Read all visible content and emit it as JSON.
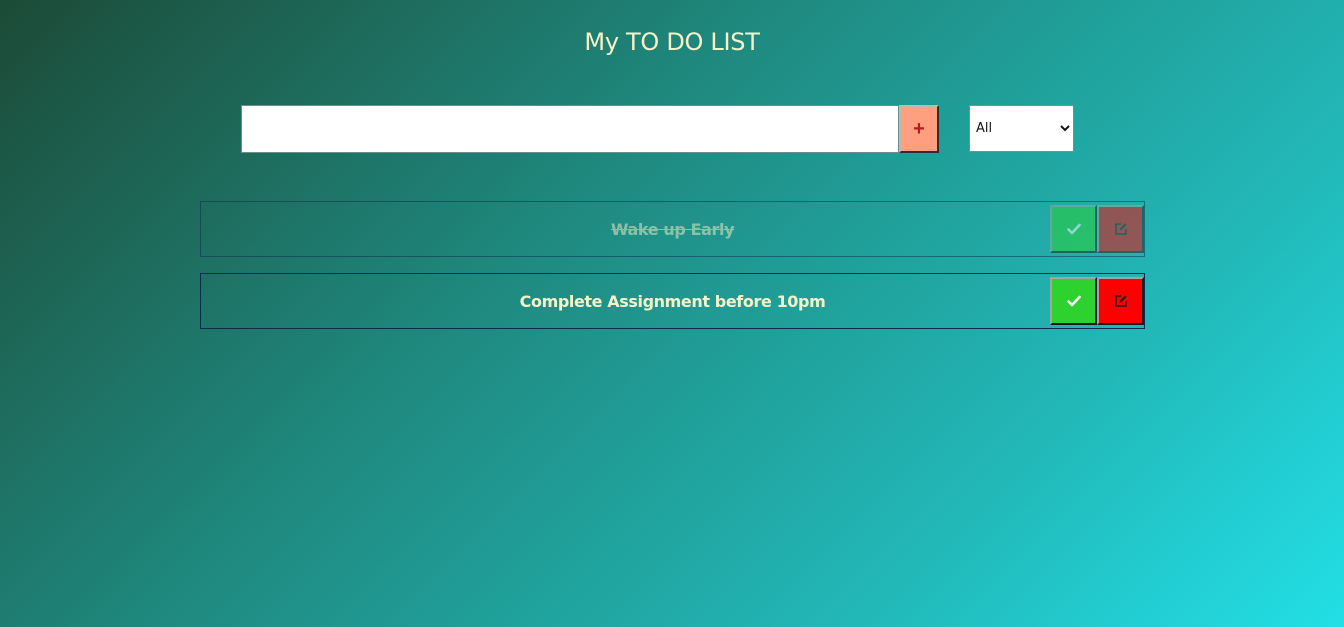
{
  "header": {
    "title": "My TO DO LIST"
  },
  "input": {
    "value": "",
    "placeholder": ""
  },
  "add_button": {
    "label": "+"
  },
  "filter": {
    "selected": "All",
    "options": [
      "All"
    ]
  },
  "todos": [
    {
      "text": "Wake up Early",
      "completed": true
    },
    {
      "text": "Complete Assignment before 10pm",
      "completed": false
    }
  ],
  "colors": {
    "title": "#f6f2c8",
    "add_button_bg": "#ff9f80",
    "add_button_fg": "#b51b1b",
    "complete_button": "#2ed22e",
    "edit_button": "#ff0000",
    "item_border": "#0e2a4f",
    "gradient_start": "#1c4b37",
    "gradient_end": "#22dfe6"
  },
  "icons": {
    "complete": "check-icon",
    "edit": "edit-icon"
  }
}
